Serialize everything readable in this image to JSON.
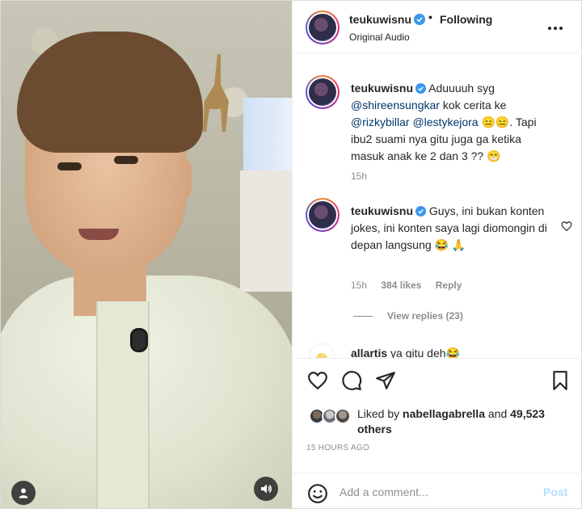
{
  "header": {
    "username": "teukuwisnu",
    "follow_status": "Following",
    "separator": "•",
    "audio_label": "Original Audio"
  },
  "comments": [
    {
      "username": "teukuwisnu",
      "text_before": "Aduuuuh syg ",
      "mention1": "@shireensungkar",
      "text_mid1": " kok cerita ke ",
      "mention2": "@rizkybillar",
      "text_mid2": " ",
      "mention3": "@lestykejora",
      "text_after": " 😑😑. Tapi ibu2 suami nya gitu juga ga ketika masuk anak ke 2 dan 3 ?? 😁",
      "time": "15h"
    },
    {
      "username": "teukuwisnu",
      "text": " Guys, ini bukan konten jokes, ini konten saya lagi diomongin di depan langsung 😂 🙏",
      "time": "15h",
      "likes": "384 likes",
      "reply": "Reply",
      "view_replies": "View replies (23)"
    },
    {
      "username": "allartis",
      "text": " ya gitu deh😂"
    }
  ],
  "actions": {
    "like_icon": "heart-icon",
    "comment_icon": "comment-bubble-icon",
    "share_icon": "paper-plane-icon",
    "save_icon": "bookmark-icon"
  },
  "likes": {
    "prefix": "Liked by ",
    "user": "nabellagabrella",
    "middle": " and ",
    "others": "49,523 others"
  },
  "timestamp": "15 HOURS AGO",
  "add_comment": {
    "placeholder": "Add a comment...",
    "post_label": "Post"
  },
  "colors": {
    "text": "#262626",
    "muted": "#8e8e8e",
    "mention": "#00376b",
    "verified": "#3897f0",
    "post_disabled": "#b2dffc"
  }
}
